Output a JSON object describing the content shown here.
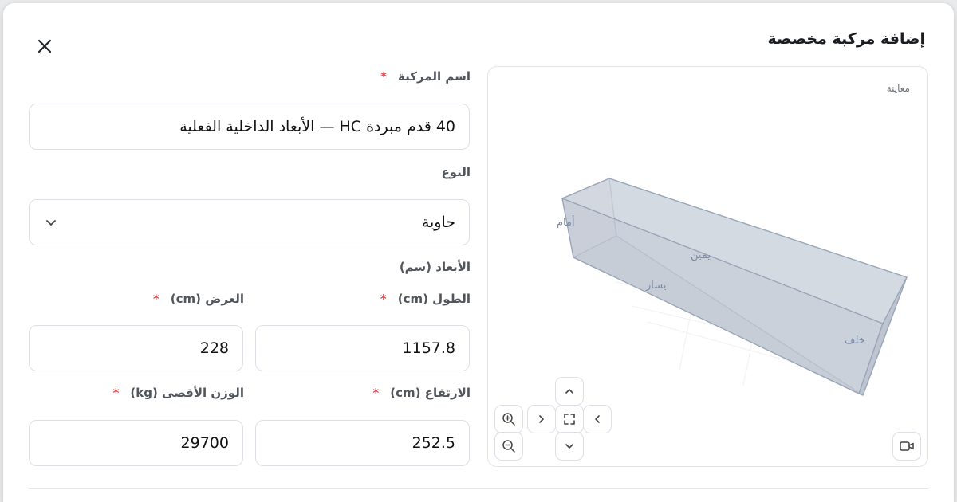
{
  "dialog": {
    "title": "إضافة مركبة مخصصة"
  },
  "form": {
    "name_label": "اسم المركبة",
    "name_value": "40 قدم مبردة HC — الأبعاد الداخلية الفعلية",
    "type_label": "النوع",
    "type_value": "حاوية",
    "dimensions_heading": "الأبعاد (سم)",
    "length_label": "الطول (cm)",
    "length_value": "1157.8",
    "width_label": "العرض (cm)",
    "width_value": "228",
    "height_label": "الارتفاع (cm)",
    "height_value": "252.5",
    "max_weight_label": "الوزن الأقصى (kg)",
    "max_weight_value": "29700",
    "required_mark": "*"
  },
  "preview": {
    "label": "معاينة",
    "face_front": "أمام",
    "face_right": "يمين",
    "face_left": "يسار",
    "face_back": "خلف"
  },
  "icons": {
    "close": "close-icon",
    "select": "chevron-down-icon",
    "zoom_in": "zoom-in-icon",
    "zoom_out": "zoom-out-icon",
    "pan_up": "chevron-up-icon",
    "pan_down": "chevron-down-icon",
    "pan_left": "chevron-left-icon",
    "pan_right": "chevron-right-icon",
    "fit": "fullscreen-icon",
    "camera": "camera-icon"
  },
  "colors": {
    "required": "#e5484d",
    "box_fill": "#c5cbd6",
    "box_stroke": "#9aa6b8"
  }
}
